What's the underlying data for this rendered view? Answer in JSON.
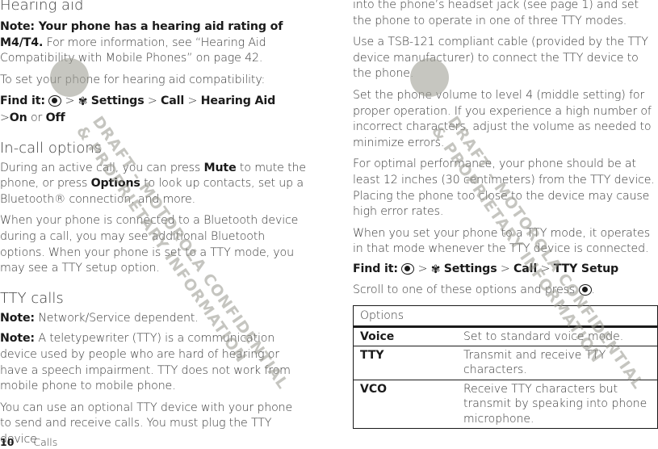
{
  "left": {
    "hearing_aid": {
      "title": "Hearing aid",
      "note_bold": "Note: Your phone has a hearing aid rating of M4/T4.",
      "note_rest": " For more information, see “Hearing Aid Compatibility with Mobile Phones” on page 42.",
      "instruction": "To set your phone for hearing aid compatibility:",
      "find_it_label": "Find it:",
      "path": [
        "Settings",
        "Call",
        "Hearing Aid",
        "On",
        "Off"
      ],
      "or": "or"
    },
    "in_call": {
      "title": "In-call options",
      "p1_a": "During an active call, you can press ",
      "p1_mute": "Mute",
      "p1_b": " to mute the phone, or press ",
      "p1_options": "Options",
      "p1_c": " to look up contacts, set up a Bluetooth® connection, and more.",
      "p2": "When your phone is connected to a Bluetooth device during a call, you may see additional Bluetooth options. When your phone is set to a TTY mode, you may see a TTY setup option."
    },
    "tty": {
      "title": "TTY calls",
      "note1_label": "Note:",
      "note1": " Network/Service dependent.",
      "note2_label": "Note:",
      "note2": " A teletypewriter (TTY) is a communication device used by people who are hard of hearing or have a speech impairment. TTY does not work from mobile phone to mobile phone.",
      "p3": "You can use an optional TTY device with your phone to send and receive calls. You must plug the TTY device"
    }
  },
  "right": {
    "p1": "into the phone’s headset jack (see page 1) and set the phone to operate in one of three TTY modes.",
    "p2": "Use a TSB-121 compliant cable (provided by the TTY device manufacturer) to connect the TTY device to the phone.",
    "p3": "Set the phone volume to level 4 (middle setting) for proper operation. If you experience a high number of incorrect characters, adjust the volume as needed to minimize errors.",
    "p4": "For optimal performance, your phone should be at least 12 inches (30 centimeters) from the TTY device. Placing the phone too close to the device may cause high error rates.",
    "p5": "When you set your phone to a TTY mode, it operates in that mode whenever the TTY device is connected.",
    "find_it_label": "Find it:",
    "path": [
      "Settings",
      "Call",
      "TTY Setup"
    ],
    "scroll_a": "Scroll to one of these options and press ",
    "scroll_b": ".",
    "table": {
      "header": "Options",
      "rows": [
        {
          "name": "Voice",
          "desc": "Set to standard voice mode."
        },
        {
          "name": "TTY",
          "desc": "Transmit and receive TTY characters."
        },
        {
          "name": "VCO",
          "desc": "Receive TTY characters but transmit by speaking into phone microphone."
        }
      ]
    }
  },
  "footer": {
    "page": "10",
    "section": "Calls"
  },
  "watermark": {
    "line1": "DRAFT - MOTOROLA CONFIDENTIAL",
    "line2": "& PROPRIETARY INFORMATION"
  },
  "icons": {
    "gt": ">",
    "gear": "✾"
  }
}
